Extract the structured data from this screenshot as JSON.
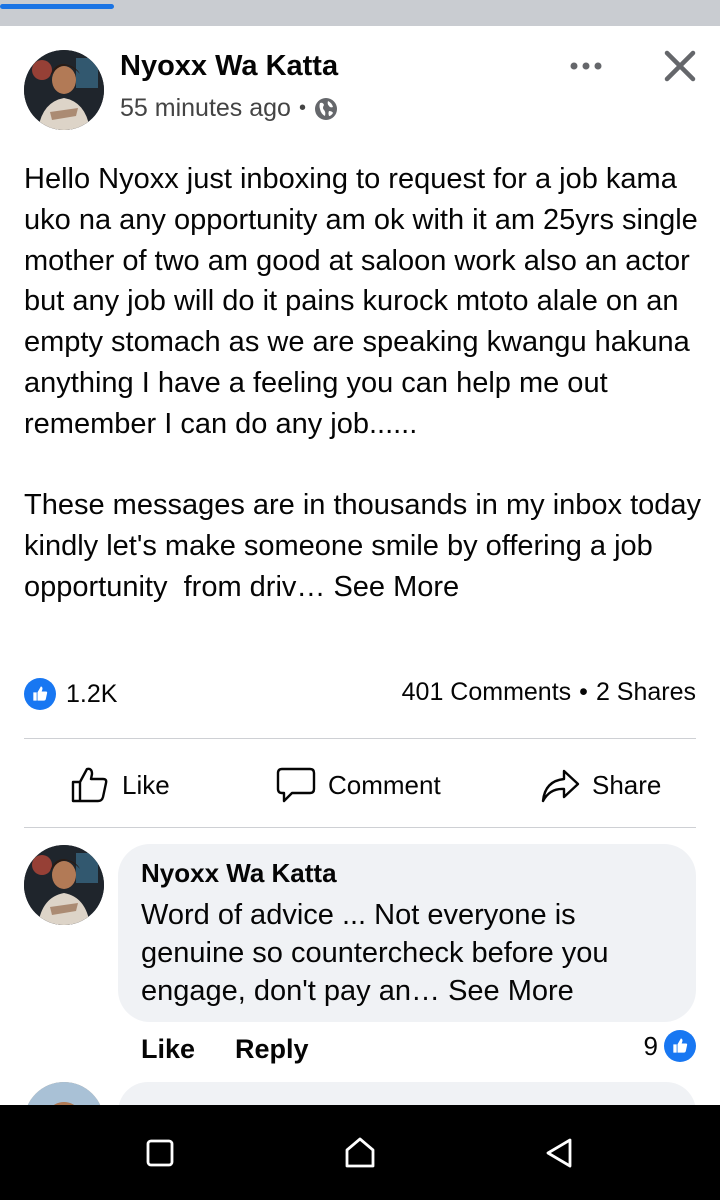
{
  "post": {
    "author": "Nyoxx Wa Katta",
    "time": "55 minutes ago",
    "separator": "•",
    "body": "Hello Nyoxx just inboxing to request for a job kama uko na any opportunity am ok with it am 25yrs single mother of two am good at saloon work also an actor but any job will do it pains kurock mtoto alale on an empty stomach as we are speaking kwangu hakuna anything I have a feeling you can help me out remember I can do any job......\n\nThese messages are in thousands in my inbox today kindly let's make someone smile by offering a job opportunity  from driv…",
    "see_more": "See More",
    "reactions_count": "1.2K",
    "comments_count": "401 Comments",
    "shares_count": "2 Shares",
    "counts_separator": "•"
  },
  "actions": {
    "like": "Like",
    "comment": "Comment",
    "share": "Share"
  },
  "comment": {
    "author": "Nyoxx Wa Katta",
    "text": "Word of advice ... Not everyone is genuine so countercheck before you engage, don't pay an…",
    "see_more": "See More",
    "like": "Like",
    "reply": "Reply",
    "reaction_count": "9"
  },
  "icons": {
    "more": "more-dots-icon",
    "close": "close-icon",
    "globe": "globe-icon",
    "like_reaction": "like-reaction-icon",
    "nav_recents": "square-icon",
    "nav_home": "home-icon",
    "nav_back": "back-triangle-icon"
  },
  "colors": {
    "accent": "#1877f2",
    "bubble": "#f0f2f5",
    "divider": "#ced0d4"
  }
}
